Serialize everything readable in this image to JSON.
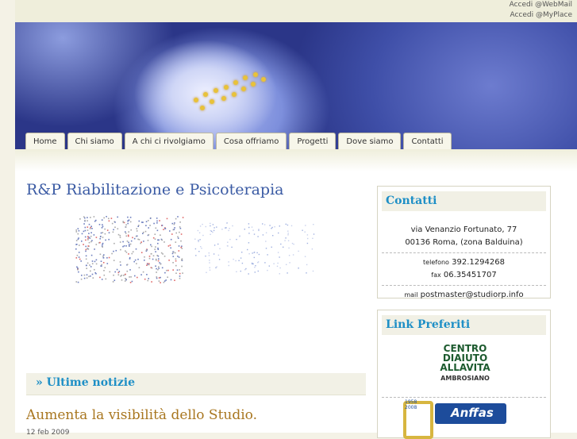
{
  "top_links": [
    "Accedi @WebMail",
    "Accedi @MyPlace"
  ],
  "nav": [
    "Home",
    "Chi siamo",
    "A chi ci rivolgiamo",
    "Cosa offriamo",
    "Progetti",
    "Dove siamo",
    "Contatti"
  ],
  "page_title": "R&P Riabilitazione e Psicoterapia",
  "news": {
    "heading": "» Ultime notizie",
    "article_title": "Aumenta la visibilità dello Studio.",
    "article_date": "12 feb 2009"
  },
  "contatti": {
    "heading": "Contatti",
    "address1": "via Venanzio Fortunato, 77",
    "address2": "00136 Roma, (zona Balduina)",
    "tel_label": "telefono",
    "tel": "392.1294268",
    "fax_label": "fax",
    "fax": "06.35451707",
    "mail_label": "mail",
    "mail": "postmaster@studiorp.info"
  },
  "links": {
    "heading": "Link Preferiti",
    "cda": {
      "line1": "CENTRO",
      "line2": "DIAIUTO",
      "line3": "ALLAVITA",
      "line4": "AMBROSIANO"
    },
    "anffas": {
      "years": "1958 2008",
      "name": "Anffas"
    }
  },
  "colors": {
    "accent_blue": "#1e8fc6",
    "title_blue": "#3b5ba4",
    "gold": "#a8761f"
  }
}
